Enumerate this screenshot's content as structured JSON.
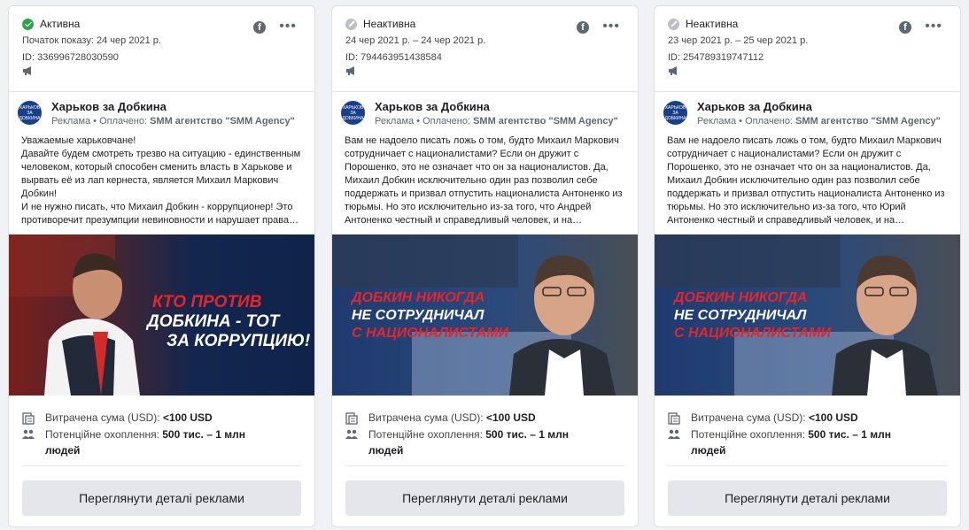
{
  "cards": [
    {
      "status": "Активна",
      "status_kind": "active",
      "dates": "Початок показу: 24 чер 2021 р.",
      "id_label": "ID: 336996728030590",
      "page_name": "Харьков за Добкина",
      "sponsor_prefix": "Реклама • Оплачено: ",
      "sponsor_name": "SMM агентство \"SMM Agency\"",
      "body": "Уважаемые харьковчане!\nДавайте будем смотреть трезво на ситуацию - единственным человеком, который способен сменить власть в Харькове и вырвать её из лап кернеста, является Михаил Маркович Добкин!\nИ не нужно писать, что Михаил Добкин - коррупционер! Это противоречит презумпции невиновности и нарушает права…",
      "image_lines": [
        "КТО ПРОТИВ",
        "ДОБКИНА - ТОТ",
        "ЗА КОРРУПЦИЮ!"
      ],
      "spend_label": "Витрачена сума (USD): ",
      "spend_value": "<100 USD",
      "reach_label": "Потенційне охоплення: ",
      "reach_value": "500 тис. – 1 млн людей",
      "button": "Переглянути деталі реклами"
    },
    {
      "status": "Неактивна",
      "status_kind": "inactive",
      "dates": "24 чер 2021 р. – 24 чер 2021 р.",
      "id_label": "ID: 794463951438584",
      "page_name": "Харьков за Добкина",
      "sponsor_prefix": "Реклама • Оплачено: ",
      "sponsor_name": "SMM агентство \"SMM Agency\"",
      "body": "Вам не надоело писать ложь о том, будто Михаил Маркович сотрудничает с националистами? Если он дружит с Порошенко, это не означает что он за националистов. Да, Михаил Добкин исключительно один раз позволил себе поддержать и призвал отпустить националиста Антоненко из тюрьмы. Но это исключительно из-за того, что Андрей Антоненко честный и справедливый человек, и на…",
      "image_lines": [
        "ДОБКИН НИКОГДА",
        "НЕ СОТРУДНИЧАЛ",
        "С НАЦИОНАЛИСТАМИ"
      ],
      "spend_label": "Витрачена сума (USD): ",
      "spend_value": "<100 USD",
      "reach_label": "Потенційне охоплення: ",
      "reach_value": "500 тис. – 1 млн людей",
      "button": "Переглянути деталі реклами"
    },
    {
      "status": "Неактивна",
      "status_kind": "inactive",
      "dates": "23 чер 2021 р. – 25 чер 2021 р.",
      "id_label": "ID: 254789319747112",
      "page_name": "Харьков за Добкина",
      "sponsor_prefix": "Реклама • Оплачено: ",
      "sponsor_name": "SMM агентство \"SMM Agency\"",
      "body": "Вам не надоело писать ложь о том, будто Михаил Маркович сотрудничает с националистами? Если он дружит с Порошенко, это не означает что он за националистов. Да, Михаил Добкин исключительно один раз позволил себе поддержать и призвал отпустить националиста Антоненко из тюрьмы. Но это исключительно из-за того, что Юрий Антоненко честный и справедливый человек, и на…",
      "image_lines": [
        "ДОБКИН НИКОГДА",
        "НЕ СОТРУДНИЧАЛ",
        "С НАЦИОНАЛИСТАМИ"
      ],
      "spend_label": "Витрачена сума (USD): ",
      "spend_value": "<100 USD",
      "reach_label": "Потенційне охоплення: ",
      "reach_value": "500 тис. – 1 млн людей",
      "button": "Переглянути деталі реклами"
    }
  ],
  "logo_text": "ХАРЬКОВ ЗА ДОБКИНА",
  "icons": {
    "platform": "facebook-icon",
    "more": "more-icon",
    "megaphone": "megaphone-icon",
    "spend": "spend-icon",
    "reach": "people-icon"
  },
  "colors": {
    "active": "#31a24c",
    "inactive": "#bcc0c4",
    "accent_red": "#e8242b"
  }
}
